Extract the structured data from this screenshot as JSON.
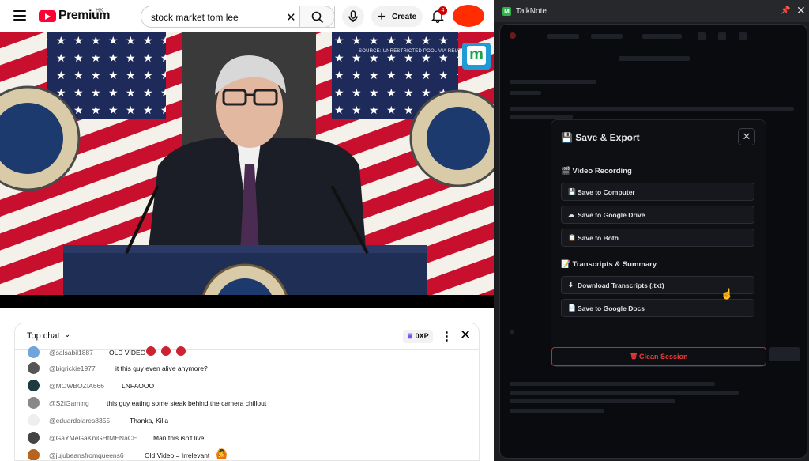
{
  "youtube": {
    "brand": "Premium",
    "region": "HK",
    "search": {
      "query": "stock market tom lee"
    },
    "create_label": "Create",
    "notifications_count": "4",
    "video_source_text": "SOURCE: UNRESTRICTED POOL VIA REUTERS",
    "video_logo_letter": "m",
    "chat": {
      "title": "Top chat",
      "xp_label": "0XP",
      "messages": [
        {
          "author": "@salsabil1887",
          "text": "OLD VIDEO"
        },
        {
          "author": "@bigrickie1977",
          "text": "it this guy even alive anymore?"
        },
        {
          "author": "@MOWBOZIA666",
          "text": "LNFAOOO"
        },
        {
          "author": "@S2iGaming",
          "text": "this guy eating some steak behind the camera chillout"
        },
        {
          "author": "@eduardolares8355",
          "text": "Thanka, Killa"
        },
        {
          "author": "@GaYMeGaKniGHtMENaCE",
          "text": "Man this isn't live"
        },
        {
          "author": "@jujubeansfromqueens6",
          "text": "Old Video = Irrelevant"
        }
      ]
    }
  },
  "talknote": {
    "title": "TalkNote",
    "icon_letter": "M",
    "modal": {
      "title": "Save & Export",
      "video_section": "Video Recording",
      "video_options": [
        "Save to Computer",
        "Save to Google Drive",
        "Save to Both"
      ],
      "transcripts_section": "Transcripts & Summary",
      "transcript_options": [
        "Download Transcripts (.txt)",
        "Save to Google Docs"
      ],
      "clean_label": "Clean Session"
    }
  },
  "colors": {
    "youtube_red": "#ff0033",
    "avatar": "#ff2d00",
    "talknote_bg": "#090b0f",
    "danger": "#f03a3a"
  }
}
